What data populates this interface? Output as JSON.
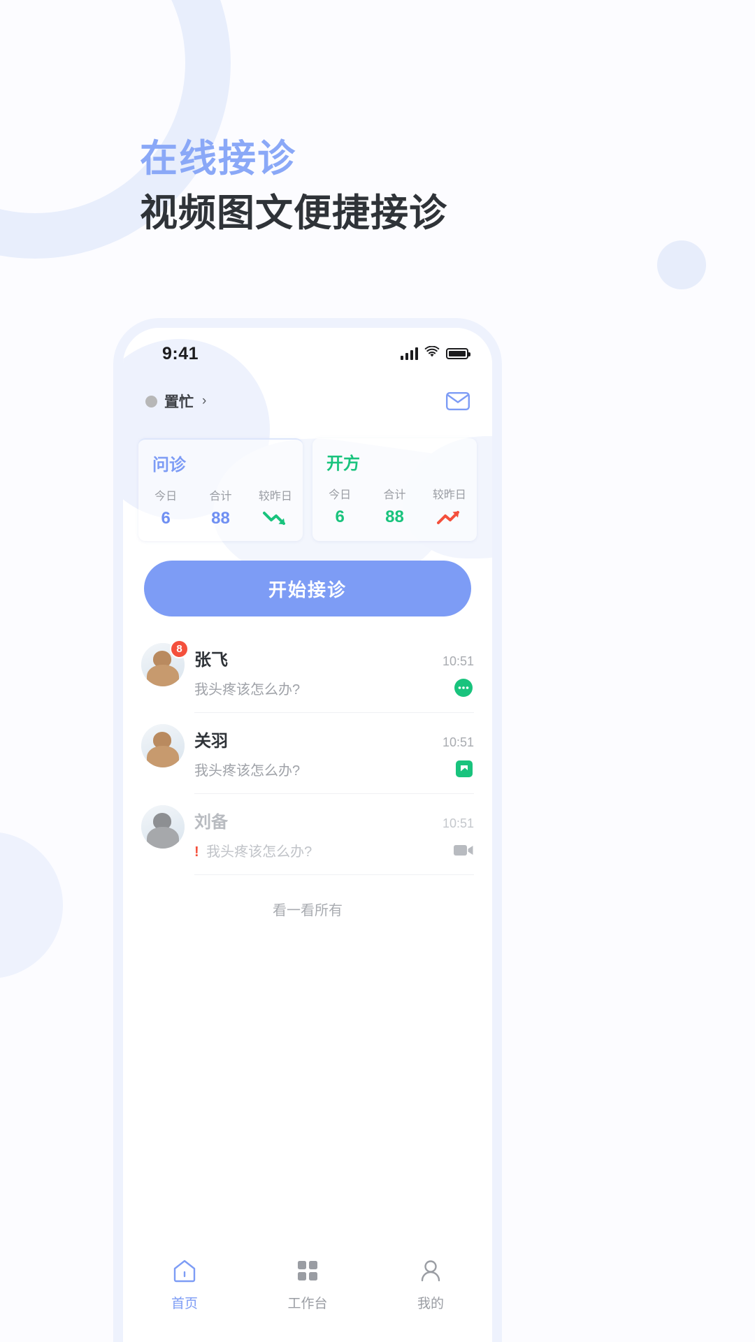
{
  "promo": {
    "title_main": "在线接诊",
    "title_sub": "视频图文便捷接诊",
    "title_main_color": "#8aa8f7",
    "title_sub_color": "#2f3338"
  },
  "status_bar": {
    "time": "9:41",
    "signal_icon": "signal-bars-icon",
    "wifi_icon": "wifi-icon",
    "battery_icon": "battery-icon"
  },
  "header": {
    "status_label": "置忙",
    "status_dot_color": "#b7b7b7",
    "chevron": "›",
    "mail_icon": "mail-icon",
    "mail_color": "#7d9cf5"
  },
  "stats": {
    "columns": [
      "今日",
      "合计",
      "较昨日"
    ],
    "cards": [
      {
        "title": "问诊",
        "accent": "#7d9cf5",
        "today": "6",
        "total": "88",
        "trend": "down",
        "trend_color": "#19c37d",
        "trend_icon": "trend-down-arrow-icon"
      },
      {
        "title": "开方",
        "accent": "#19c37d",
        "today": "6",
        "total": "88",
        "trend": "up",
        "trend_color": "#f4503c",
        "trend_icon": "trend-up-arrow-icon"
      }
    ]
  },
  "primary_button": {
    "label": "开始接诊",
    "color": "#7d9cf5"
  },
  "chat_list": {
    "rows": [
      {
        "name": "张飞",
        "message": "我头疼该怎么办?",
        "time": "10:51",
        "badge": "8",
        "badge_color": "#f4503c",
        "status_icon": "chat-bubble-icon",
        "status_icon_color": "#19c37d",
        "muted": false,
        "alert": ""
      },
      {
        "name": "关羽",
        "message": "我头疼该怎么办?",
        "time": "10:51",
        "badge": "",
        "badge_color": "#f4503c",
        "status_icon": "image-card-icon",
        "status_icon_color": "#19c37d",
        "muted": false,
        "alert": ""
      },
      {
        "name": "刘备",
        "message": "我头疼该怎么办?",
        "time": "10:51",
        "badge": "",
        "badge_color": "#f4503c",
        "status_icon": "video-camera-icon",
        "status_icon_color": "#b8bbc0",
        "muted": true,
        "alert": "!"
      }
    ],
    "see_all_label": "看一看所有"
  },
  "bottom_nav": {
    "items": [
      {
        "label": "首页",
        "icon": "home-icon",
        "active": true
      },
      {
        "label": "工作台",
        "icon": "grid-icon",
        "active": false
      },
      {
        "label": "我的",
        "icon": "person-icon",
        "active": false
      }
    ],
    "active_color": "#7d9cf5",
    "inactive_color": "#9a9da3"
  }
}
